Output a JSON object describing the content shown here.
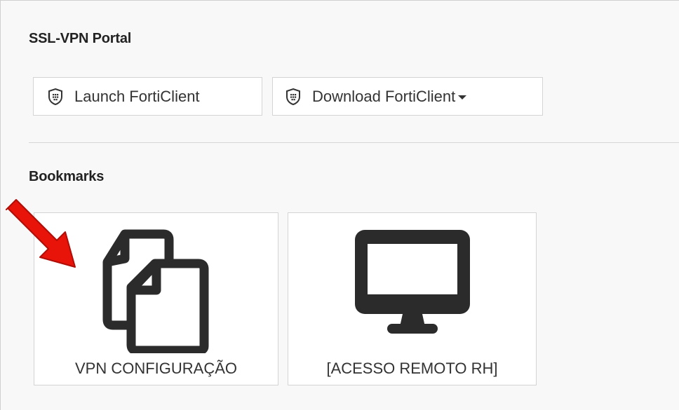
{
  "portal": {
    "title": "SSL-VPN Portal",
    "launch_label": "Launch FortiClient",
    "download_label": "Download FortiClient"
  },
  "bookmarks": {
    "title": "Bookmarks",
    "items": [
      {
        "label": "VPN CONFIGURAÇÃO",
        "icon": "documents-icon"
      },
      {
        "label": "[ACESSO REMOTO RH]",
        "icon": "monitor-icon"
      }
    ]
  },
  "colors": {
    "arrow": "#e8140a",
    "icon": "#2b2b2b",
    "background": "#f8f8f8"
  }
}
